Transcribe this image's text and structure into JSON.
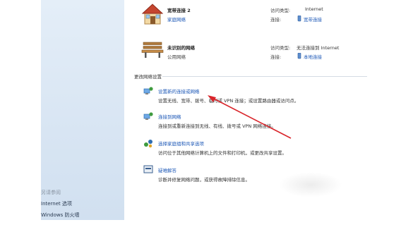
{
  "networks": [
    {
      "title": "宽带连接  2",
      "type": "家庭网络",
      "access_label": "访问类型:",
      "access_value": "Internet",
      "connection_label": "连接:",
      "connection_value": "宽带连接"
    },
    {
      "title": "未识别的网络",
      "type": "公用网络",
      "access_label": "访问类型:",
      "access_value": "无法连接到 Internet",
      "connection_label": "连接:",
      "connection_value": "本地连接"
    }
  ],
  "settings": {
    "section_title": "更改网络设置",
    "tasks": [
      {
        "link": "设置新的连接或网络",
        "desc": "设置无线、宽带、拨号、临时或 VPN 连接；或设置路由器或访问点。"
      },
      {
        "link": "连接到网络",
        "desc": "连接到或重新连接到无线、有线、拨号或 VPN 网络连接。"
      },
      {
        "link": "选择家庭组和共享选项",
        "desc": "访问位于其他网络计算机上的文件和打印机，或更改共享设置。"
      },
      {
        "link": "疑难解答",
        "desc": "诊断并修复网络问题，或获得故障排除信息。"
      }
    ]
  },
  "sidebar": {
    "see_also": "另请参阅",
    "items": [
      "Internet 选项",
      "Windows 防火墙"
    ]
  },
  "annotation": {
    "arrow_color": "#d9252b"
  }
}
